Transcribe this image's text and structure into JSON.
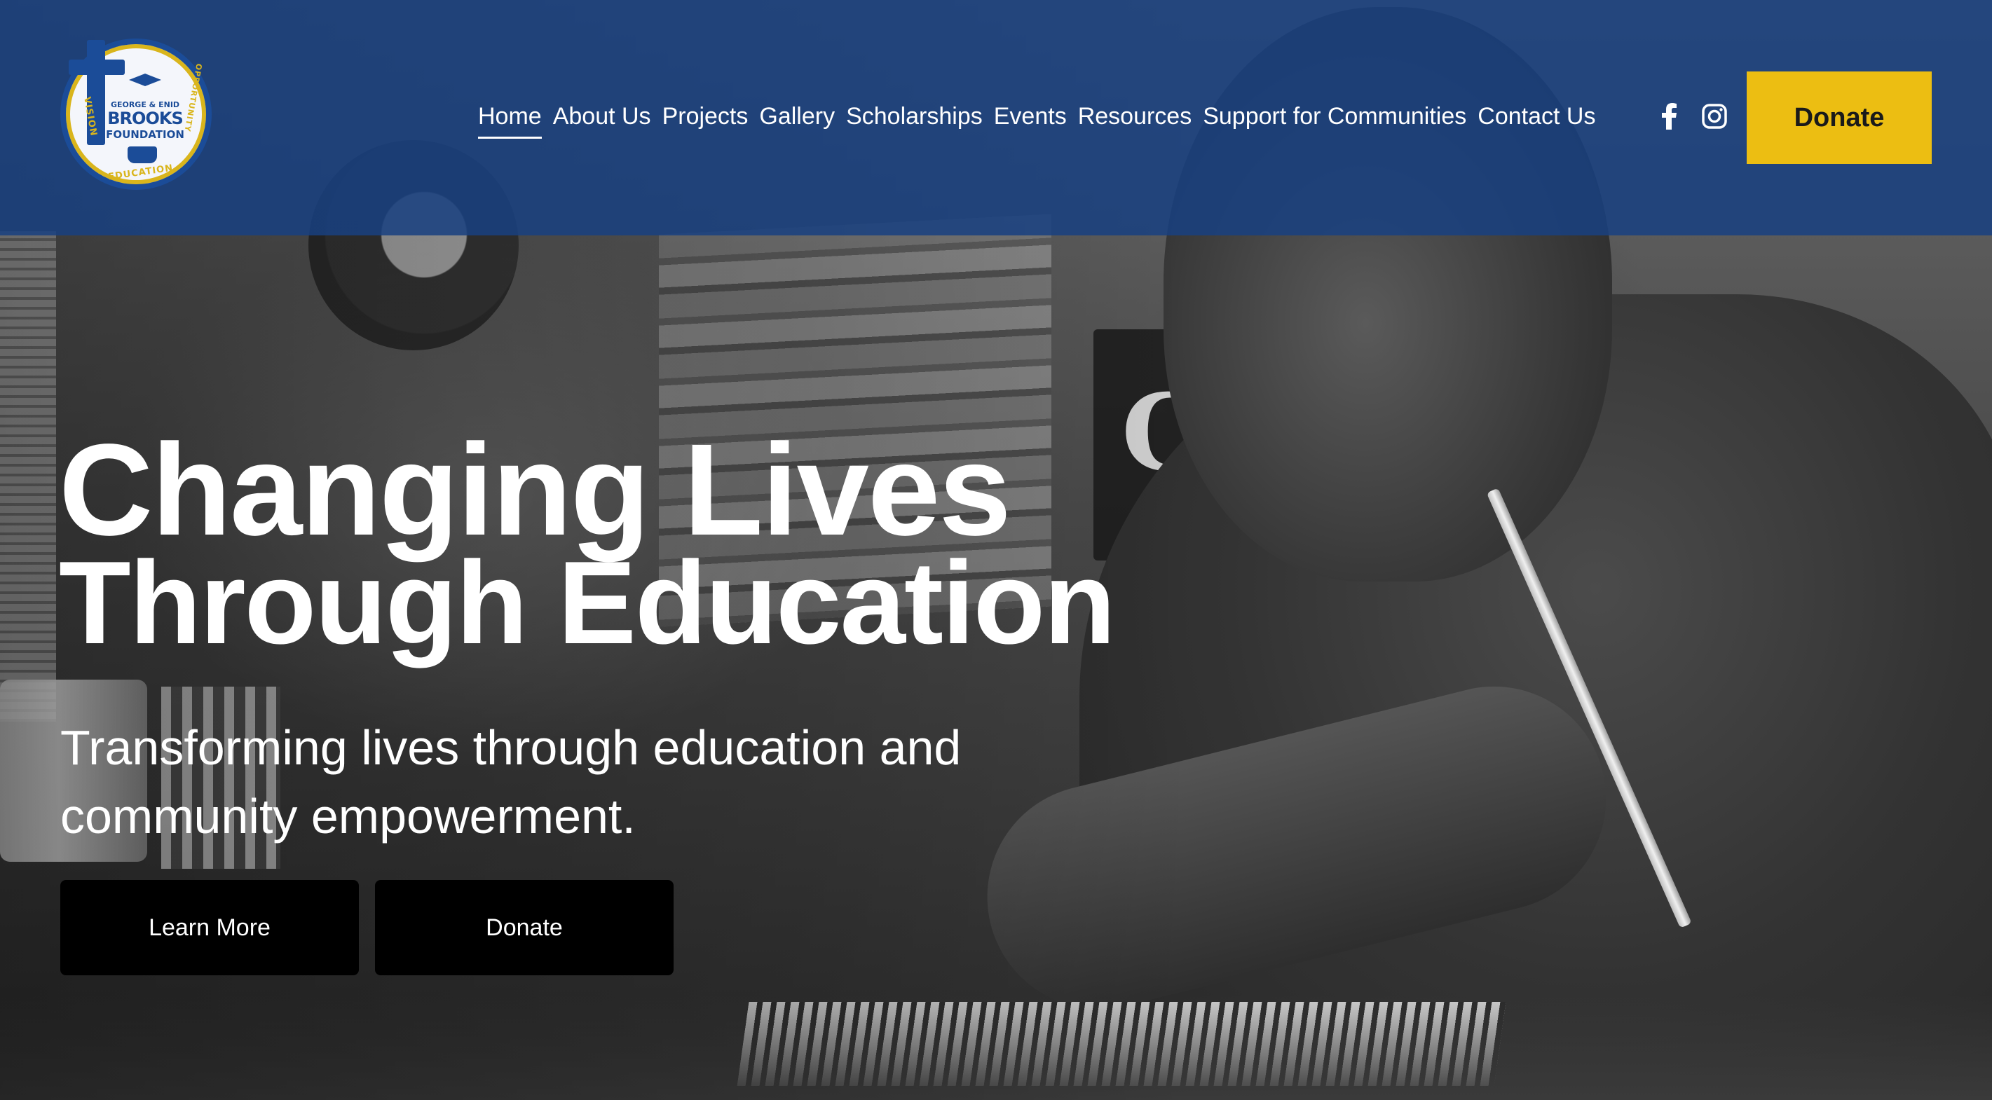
{
  "logo": {
    "alt": "George & Enid Brooks Foundation",
    "top_text": "GEORGE & ENID",
    "name": "BROOKS",
    "subtitle": "FOUNDATION",
    "ring_left": "VISION",
    "ring_right": "OPPORTUNITY",
    "ring_bottom": "EDUCATION"
  },
  "nav": {
    "items": [
      {
        "label": "Home",
        "active": true
      },
      {
        "label": "About Us"
      },
      {
        "label": "Projects"
      },
      {
        "label": "Gallery"
      },
      {
        "label": "Scholarships"
      },
      {
        "label": "Events"
      },
      {
        "label": "Resources"
      },
      {
        "label": "Support for Communities"
      },
      {
        "label": "Contact Us"
      }
    ]
  },
  "social": {
    "facebook": "facebook-icon",
    "instagram": "instagram-icon"
  },
  "header": {
    "donate_label": "Donate"
  },
  "hero": {
    "title_line1": "Changing Lives",
    "title_line2": "Through Education",
    "subtitle_line1": "Transforming lives through education and",
    "subtitle_line2": "community empowerment.",
    "learn_more_label": "Learn More",
    "donate_label": "Donate"
  },
  "background_sign_text": "Cr",
  "colors": {
    "header_bg": "#184080",
    "donate_accent": "#ECBE12",
    "button_bg": "#000000",
    "text": "#FFFFFF"
  }
}
